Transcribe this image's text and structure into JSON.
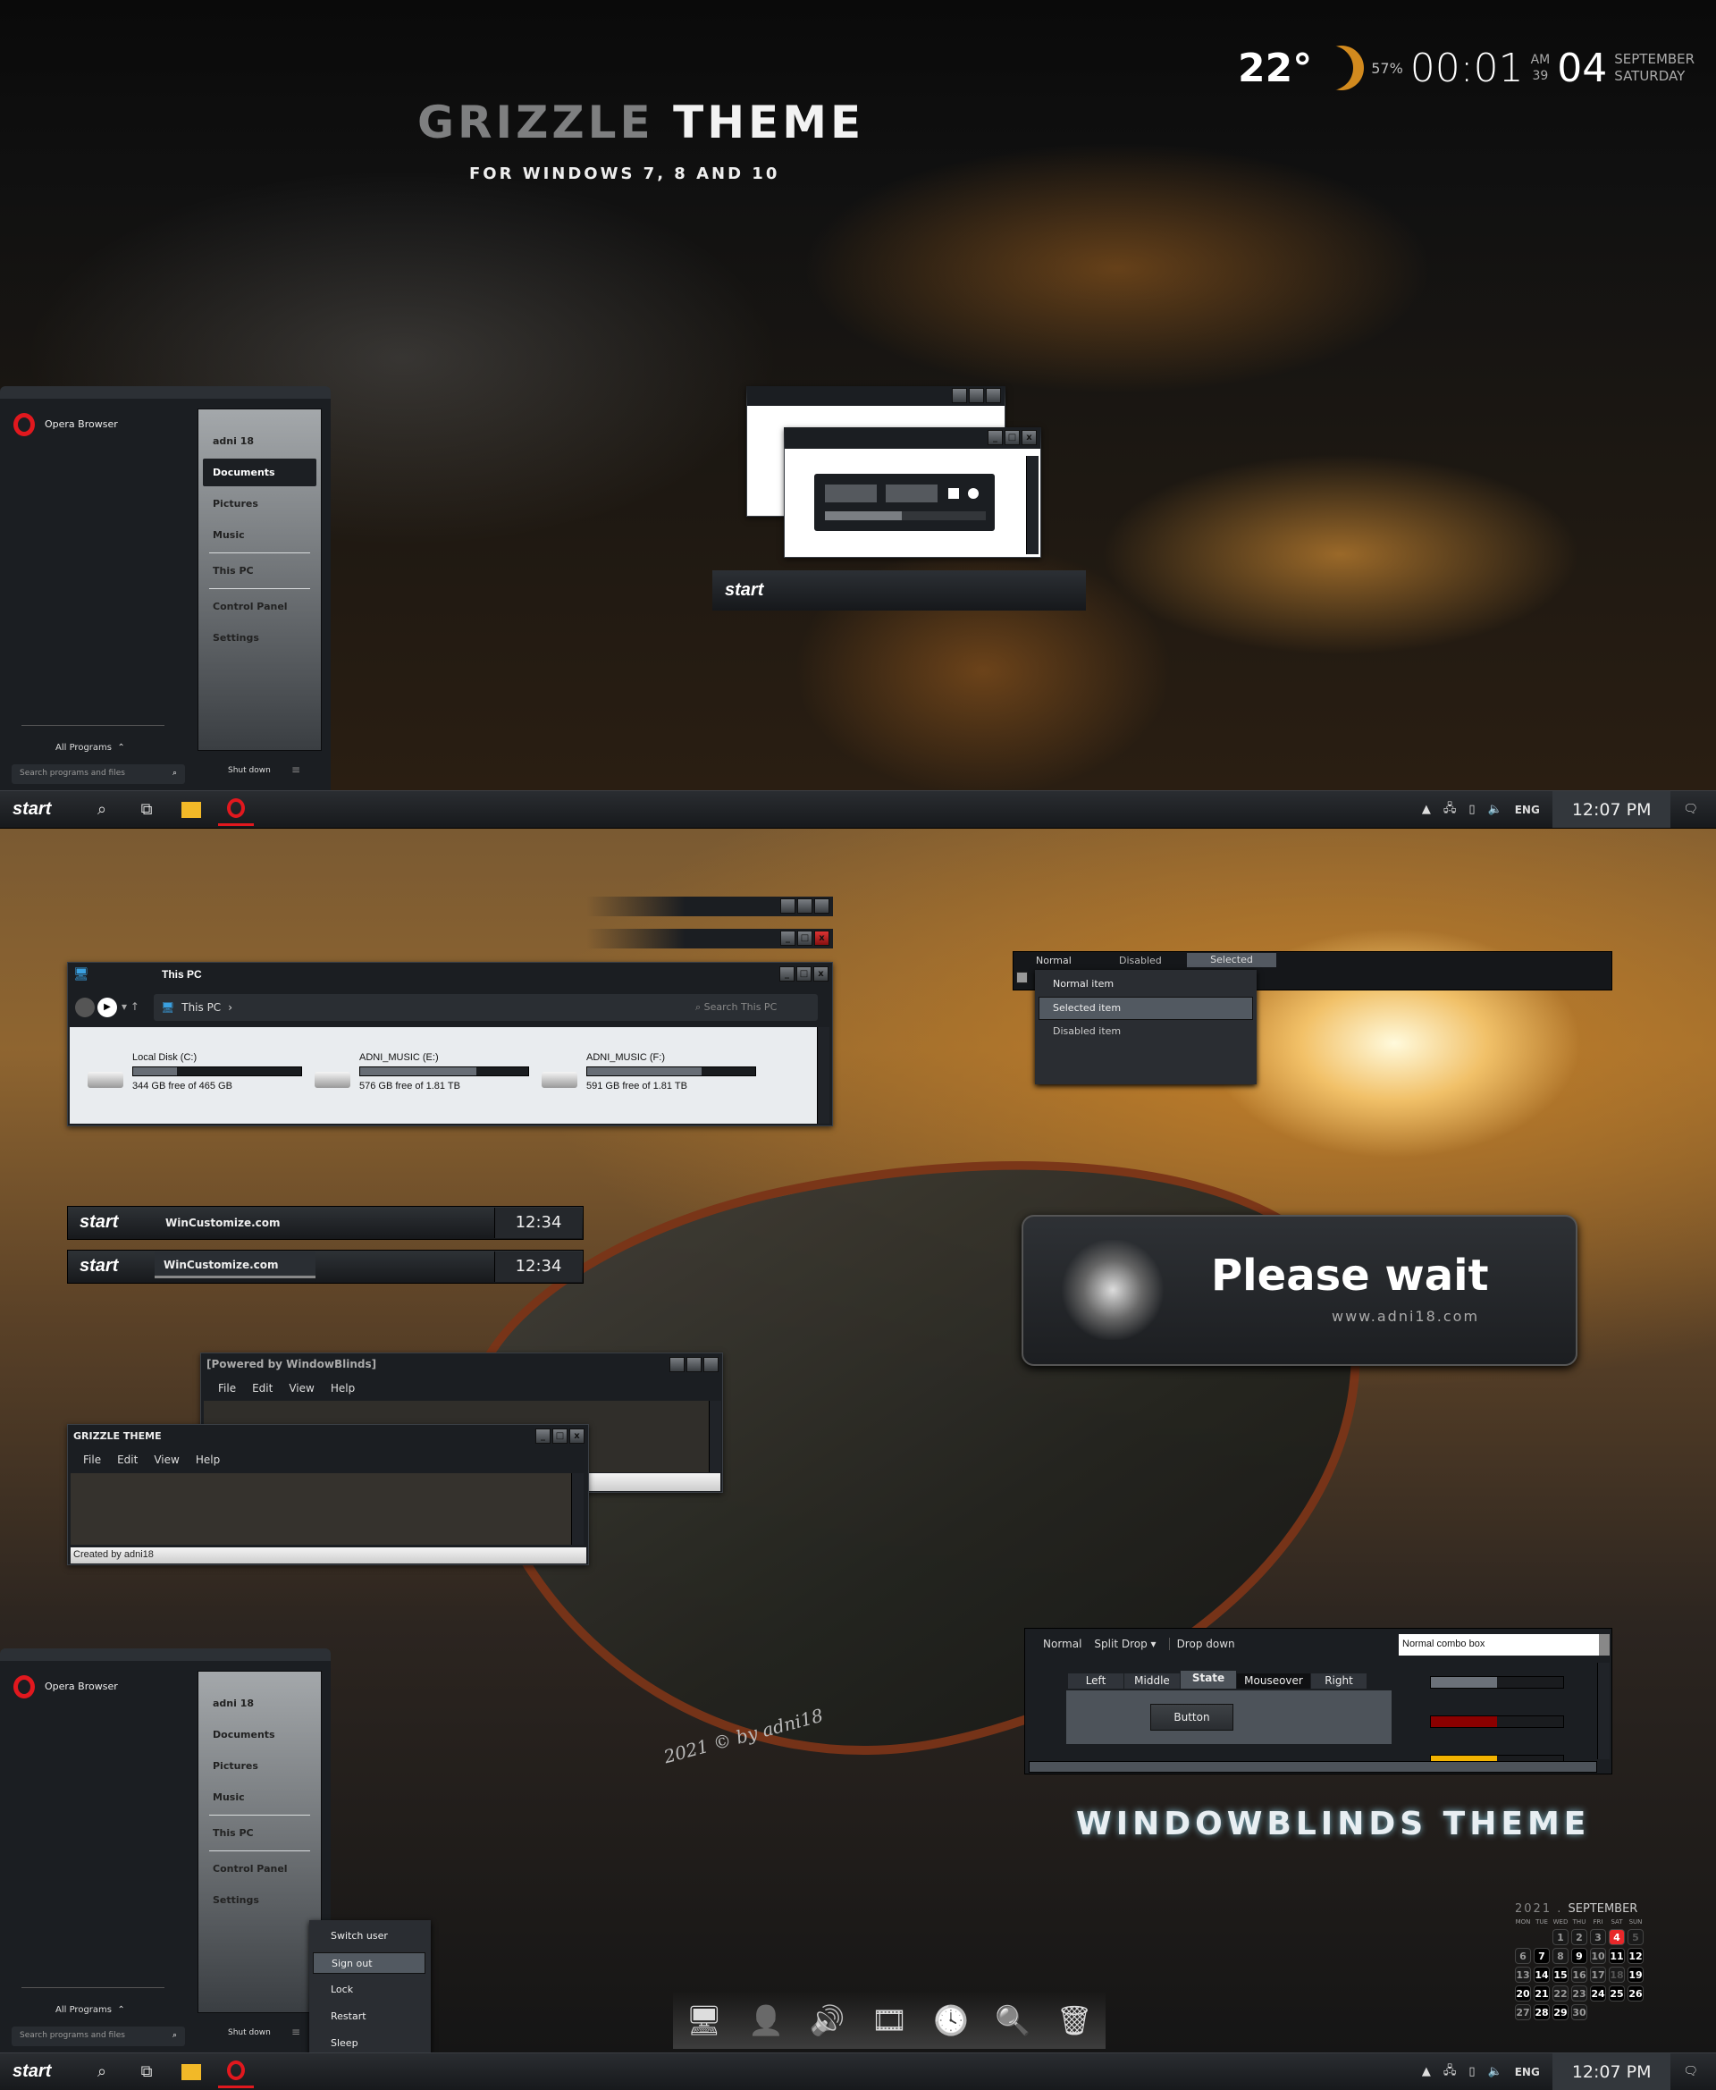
{
  "hero": {
    "title_part1": "GRIZZLE",
    "title_part2": "THEME",
    "subtitle": "FOR WINDOWS 7, 8 AND 10",
    "bottom_title": "WINDOWBLINDS THEME",
    "signature": "2021 © by adni18"
  },
  "weather": {
    "temperature": "22°",
    "humidity": "57%",
    "time": "00:01",
    "ampm": "AM",
    "seconds": "39",
    "day": "04",
    "month": "SEPTEMBER",
    "weekday": "SATURDAY",
    "icon": "moon-cloud-icon"
  },
  "start_menu": {
    "pinned": "Opera Browser",
    "user": "adni 18",
    "items": [
      "Documents",
      "Pictures",
      "Music",
      "This PC",
      "Control Panel",
      "Settings"
    ],
    "selected": "Documents",
    "all_programs": "All Programs",
    "search_placeholder": "Search programs and files",
    "shutdown": "Shut down"
  },
  "power_menu": {
    "items": [
      "Switch user",
      "Sign out",
      "Lock",
      "Restart",
      "Sleep"
    ],
    "selected": "Sign out"
  },
  "taskbar": {
    "start": "start",
    "lang": "ENG",
    "clock": "12:07 PM",
    "icons": [
      "search-icon",
      "task-view-icon",
      "file-explorer-icon",
      "opera-icon"
    ]
  },
  "mini_start": {
    "label": "start"
  },
  "explorer": {
    "title": "This PC",
    "breadcrumb": "This PC",
    "search_placeholder": "Search This PC",
    "drives": [
      {
        "name": "Local Disk (C:)",
        "free": "344 GB free of 465 GB",
        "used_pct": 26
      },
      {
        "name": "ADNI_MUSIC (E:)",
        "free": "576 GB free of 1.81 TB",
        "used_pct": 69
      },
      {
        "name": "ADNI_MUSIC (F:)",
        "free": "591 GB free of 1.81 TB",
        "used_pct": 68
      }
    ]
  },
  "menu_demo": {
    "tabs": [
      "Normal",
      "Disabled",
      "Selected"
    ],
    "items": [
      "Normal item",
      "Selected item",
      "Disabled item"
    ]
  },
  "taskbar_preview": {
    "start": "start",
    "app": "WinCustomize.com",
    "clock": "12:34"
  },
  "please_wait": {
    "text": "Please wait",
    "url": "www.adni18.com"
  },
  "wb_window": {
    "title": "[Powered by WindowBlinds]",
    "menu": [
      "File",
      "Edit",
      "View",
      "Help"
    ]
  },
  "grizzle_window": {
    "title": "GRIZZLE THEME",
    "menu": [
      "File",
      "Edit",
      "View",
      "Help"
    ],
    "status": "Created by adni18"
  },
  "controls": {
    "toolbar": [
      "Normal",
      "Split Drop",
      "Drop down"
    ],
    "combo": "Normal combo box",
    "tabs": [
      "Left",
      "Middle",
      "State",
      "Mouseover",
      "Right"
    ],
    "active_tab": "State",
    "button": "Button",
    "progress": [
      {
        "pct": 50,
        "color": "#6b7179"
      },
      {
        "pct": 50,
        "color": "#8b0000"
      },
      {
        "pct": 50,
        "color": "#f3b300"
      }
    ]
  },
  "calendar": {
    "year": "2021",
    "month": "SEPTEMBER",
    "weekdays": [
      "MON",
      "TUE",
      "WED",
      "THU",
      "FRI",
      "SAT",
      "SUN"
    ],
    "first_weekday": 3,
    "days": 30,
    "today": 4,
    "today_color": "#e8282a",
    "bold_days": [
      7,
      9,
      11,
      12,
      14,
      15,
      19,
      20,
      21,
      24,
      25,
      26,
      28,
      29
    ],
    "dim_days": [
      5,
      18
    ]
  },
  "dock": {
    "icons": [
      "computer-icon",
      "user-icon",
      "speaker-icon",
      "film-reel-icon",
      "clock-icon",
      "search-icon",
      "trash-icon"
    ]
  }
}
